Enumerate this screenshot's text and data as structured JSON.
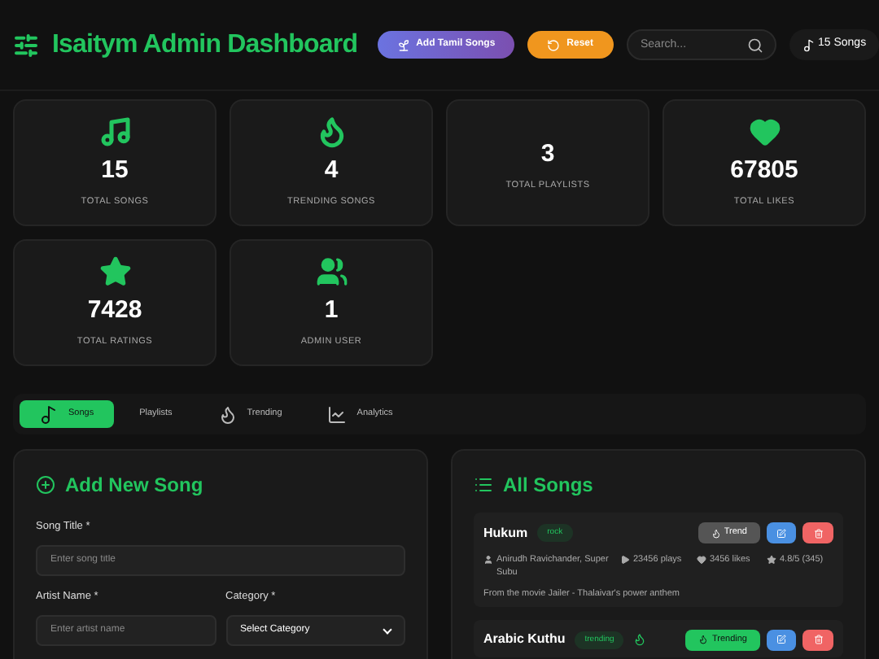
{
  "header": {
    "title": "Isaitym Admin Dashboard",
    "add_button": "Add Tamil Songs",
    "reset_button": "Reset",
    "search": {
      "placeholder": "Search..."
    },
    "song_count": "15 Songs"
  },
  "stats": [
    {
      "kind": "songs",
      "value": "15",
      "label": "TOTAL SONGS"
    },
    {
      "kind": "trending",
      "value": "4",
      "label": "TRENDING SONGS"
    },
    {
      "kind": "playlists",
      "value": "3",
      "label": "TOTAL PLAYLISTS"
    },
    {
      "kind": "likes",
      "value": "67805",
      "label": "TOTAL LIKES"
    },
    {
      "kind": "ratings",
      "value": "7428",
      "label": "TOTAL RATINGS"
    },
    {
      "kind": "users",
      "value": "1",
      "label": "ADMIN USER"
    }
  ],
  "tabs": [
    {
      "kind": "songs",
      "label": "Songs",
      "selected": true
    },
    {
      "kind": "playlists",
      "label": "Playlists",
      "selected": false
    },
    {
      "kind": "trending",
      "label": "Trending",
      "selected": false
    },
    {
      "kind": "analytics",
      "label": "Analytics",
      "selected": false
    }
  ],
  "add_form": {
    "title": "Add New Song",
    "fields": [
      {
        "label": "Song Title *",
        "placeholder": "Enter song title"
      }
    ],
    "artist": {
      "label": "Artist Name *",
      "placeholder": "Enter artist name"
    },
    "category": {
      "label": "Category *",
      "value": "Select Category"
    }
  },
  "song_list": {
    "title": "All Songs",
    "songs": [
      {
        "title": "Hukum",
        "tag": "rock",
        "trending": false,
        "trend_button": "Trend",
        "artist": "Anirudh Ravichander, Super Subu",
        "plays": "23456 plays",
        "likes": "3456 likes",
        "rating": "4.8/5 (345)",
        "description": "From the movie Jailer - Thalaivar's power anthem"
      },
      {
        "title": "Arabic Kuthu",
        "tag": "trending",
        "trending": true,
        "trend_button": "Trending"
      }
    ]
  }
}
